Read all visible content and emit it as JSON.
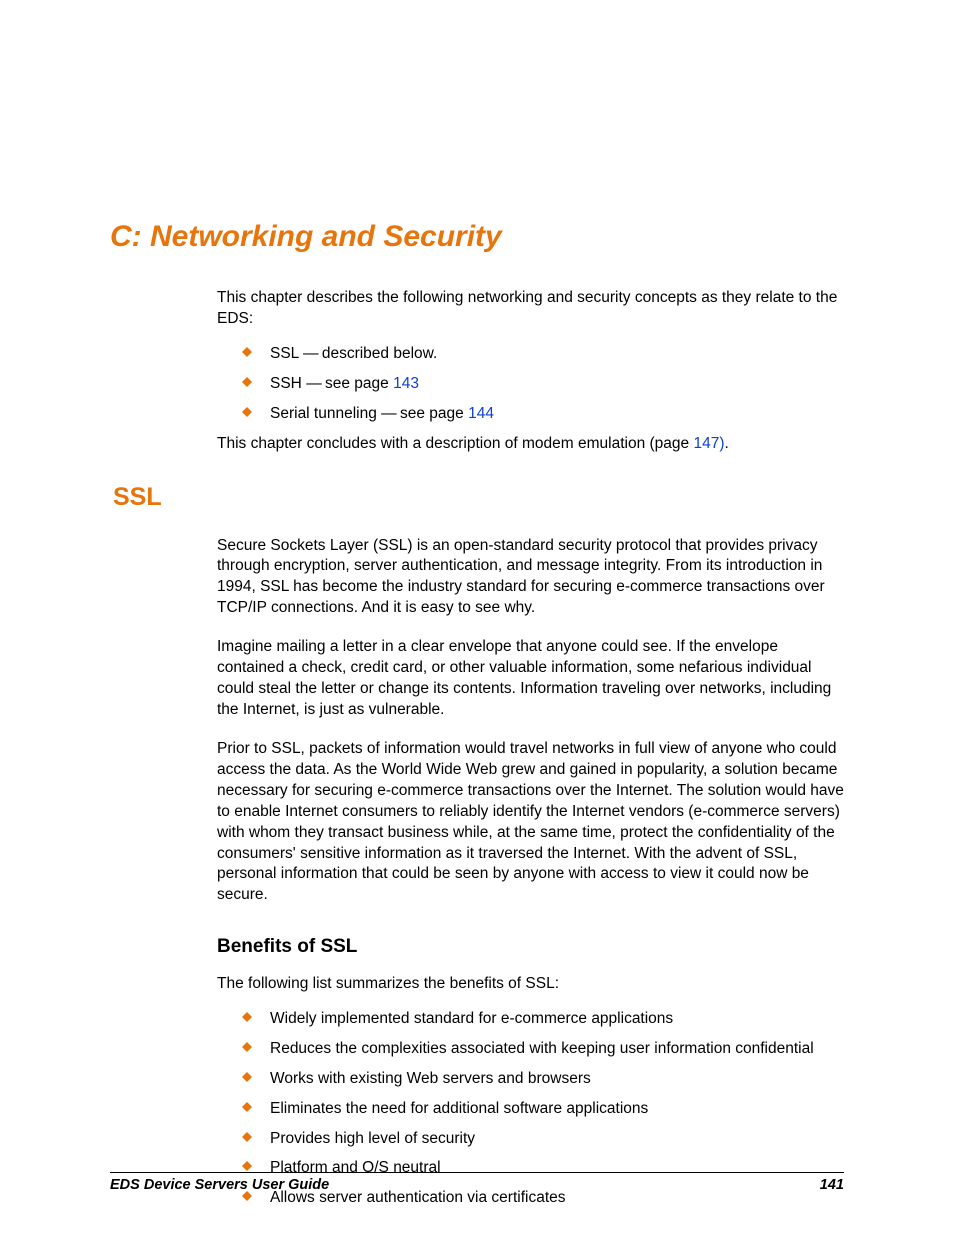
{
  "chapter": {
    "title": "C: Networking and Security"
  },
  "intro": {
    "para": "This chapter describes the following networking and security concepts as they relate to the EDS:",
    "items": [
      {
        "prefix": "SSL ",
        "dash": "—",
        "suffix": " described below."
      },
      {
        "prefix": "SSH ",
        "dash": "—",
        "suffix": " see page ",
        "link": "143"
      },
      {
        "prefix": "Serial tunneling ",
        "dash": "—",
        "suffix": " see page ",
        "link": "144"
      }
    ],
    "concludes_prefix": "This chapter concludes with a description of modem emulation (page ",
    "concludes_link": "147)",
    "concludes_suffix": "."
  },
  "ssl": {
    "heading": "SSL",
    "para1": "Secure Sockets Layer (SSL) is an open-standard security protocol that provides privacy through encryption, server authentication, and message integrity. From its introduction in 1994, SSL has become the industry standard for securing e-commerce transactions over TCP/IP connections. And it is easy to see why.",
    "para2": "Imagine mailing a letter in a clear envelope that anyone could see. If the envelope contained a check, credit card, or other valuable information, some nefarious individual could steal the letter or change its contents. Information traveling over networks, including the Internet, is just as vulnerable.",
    "para3": "Prior to SSL, packets of information would travel networks in full view of anyone who could access the data. As the World Wide Web grew and gained in popularity, a solution became necessary for securing e-commerce transactions over the Internet. The solution would have to enable Internet consumers to reliably identify the Internet vendors (e-commerce servers) with whom they transact business while, at the same time, protect the confidentiality of the consumers' sensitive information as it traversed the Internet. With the advent of SSL, personal information that could be seen by anyone with access to view it could now be secure."
  },
  "benefits": {
    "heading": "Benefits of SSL",
    "intro": "The following list summarizes the benefits of SSL:",
    "items": [
      "Widely implemented standard for e-commerce applications",
      "Reduces the complexities associated with keeping user information confidential",
      "Works with existing Web servers and browsers",
      "Eliminates the need for additional software applications",
      "Provides high level of security",
      "Platform and O/S neutral",
      "Allows server authentication via certificates"
    ]
  },
  "footer": {
    "left": "EDS Device Servers User Guide",
    "right": "141"
  }
}
